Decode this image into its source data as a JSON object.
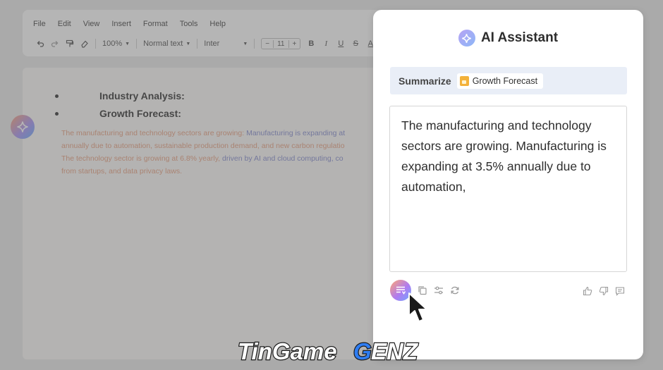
{
  "editor": {
    "menu": [
      "File",
      "Edit",
      "View",
      "Insert",
      "Format",
      "Tools",
      "Help"
    ],
    "toolbar": {
      "zoom": "100%",
      "style": "Normal text",
      "font": "Inter",
      "size_minus": "−",
      "font_size": "11",
      "size_plus": "+",
      "bold": "B",
      "italic": "I",
      "underline": "U",
      "strike": "S",
      "text_color": "A"
    },
    "document": {
      "bullets": [
        "Industry Analysis:",
        "Growth Forecast:"
      ],
      "para_lines": [
        {
          "normal": "The manufacturing and technology sectors are growing: ",
          "highlight": "Manufacturing is expanding at"
        },
        {
          "normal": "annually due to automation, sustainable production demand, and new carbon regulatio",
          "highlight": ""
        },
        {
          "normal": "The technology sector is growing at 6.8% yearly, ",
          "highlight": "driven by AI and cloud computing, co"
        },
        {
          "normal": "from startups, and data privacy laws.",
          "highlight": ""
        }
      ]
    }
  },
  "assistant": {
    "title": "AI Assistant",
    "prompt_label": "Summarize",
    "chip_label": "Growth Forecast",
    "result_text": "The manufacturing and technology sectors are growing. Manufacturing is expanding at 3.5% annually due to automation,"
  },
  "watermark": "TinGameGENZ",
  "colors": {
    "accent_start": "#ffa573",
    "accent_mid": "#b07bf0",
    "accent_end": "#6fa8ff",
    "prompt_bg": "#e9eef7",
    "doc_text": "#e79a78",
    "doc_highlight": "#7c84cc"
  }
}
